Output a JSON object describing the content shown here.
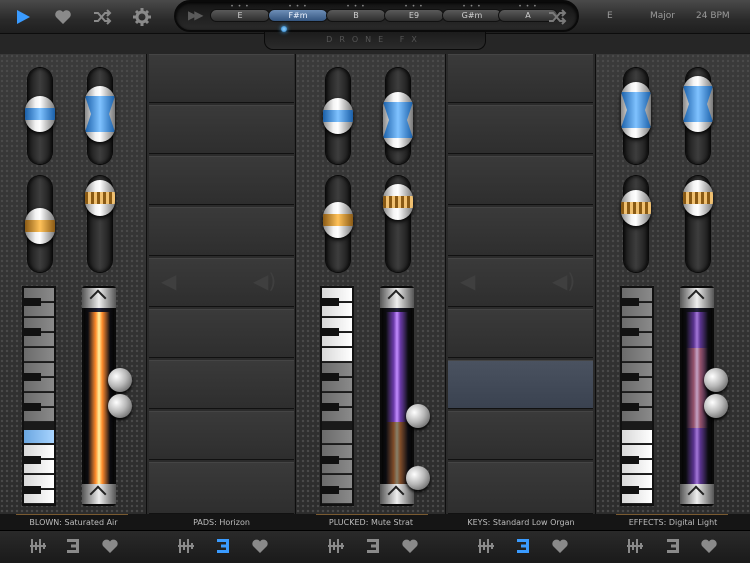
{
  "topbar": {
    "chords": [
      {
        "label": "E",
        "active": false
      },
      {
        "label": "F#m",
        "active": true
      },
      {
        "label": "B",
        "active": false
      },
      {
        "label": "E9",
        "active": false
      },
      {
        "label": "G#m",
        "active": false
      },
      {
        "label": "A",
        "active": false
      }
    ],
    "key": "E",
    "scale": "Major",
    "tempo": "24 BPM"
  },
  "logo_text": "DRONE FX",
  "channels": [
    {
      "label": "BLOWN: Saturated Air"
    },
    {
      "label": "PADS: Horizon"
    },
    {
      "label": "PLUCKED: Mute Strat"
    },
    {
      "label": "KEYS: Standard Low Organ"
    },
    {
      "label": "EFFECTS: Digital Light"
    }
  ],
  "icons": {
    "play": "play-icon",
    "favorite": "heart-icon",
    "shuffle": "shuffle-icon",
    "settings": "gear-icon",
    "mixer": "mixer-icon",
    "list": "list-icon"
  },
  "colors": {
    "accent": "#3a9bff",
    "orange": "#ffb040",
    "text": "#bdbdbd"
  }
}
